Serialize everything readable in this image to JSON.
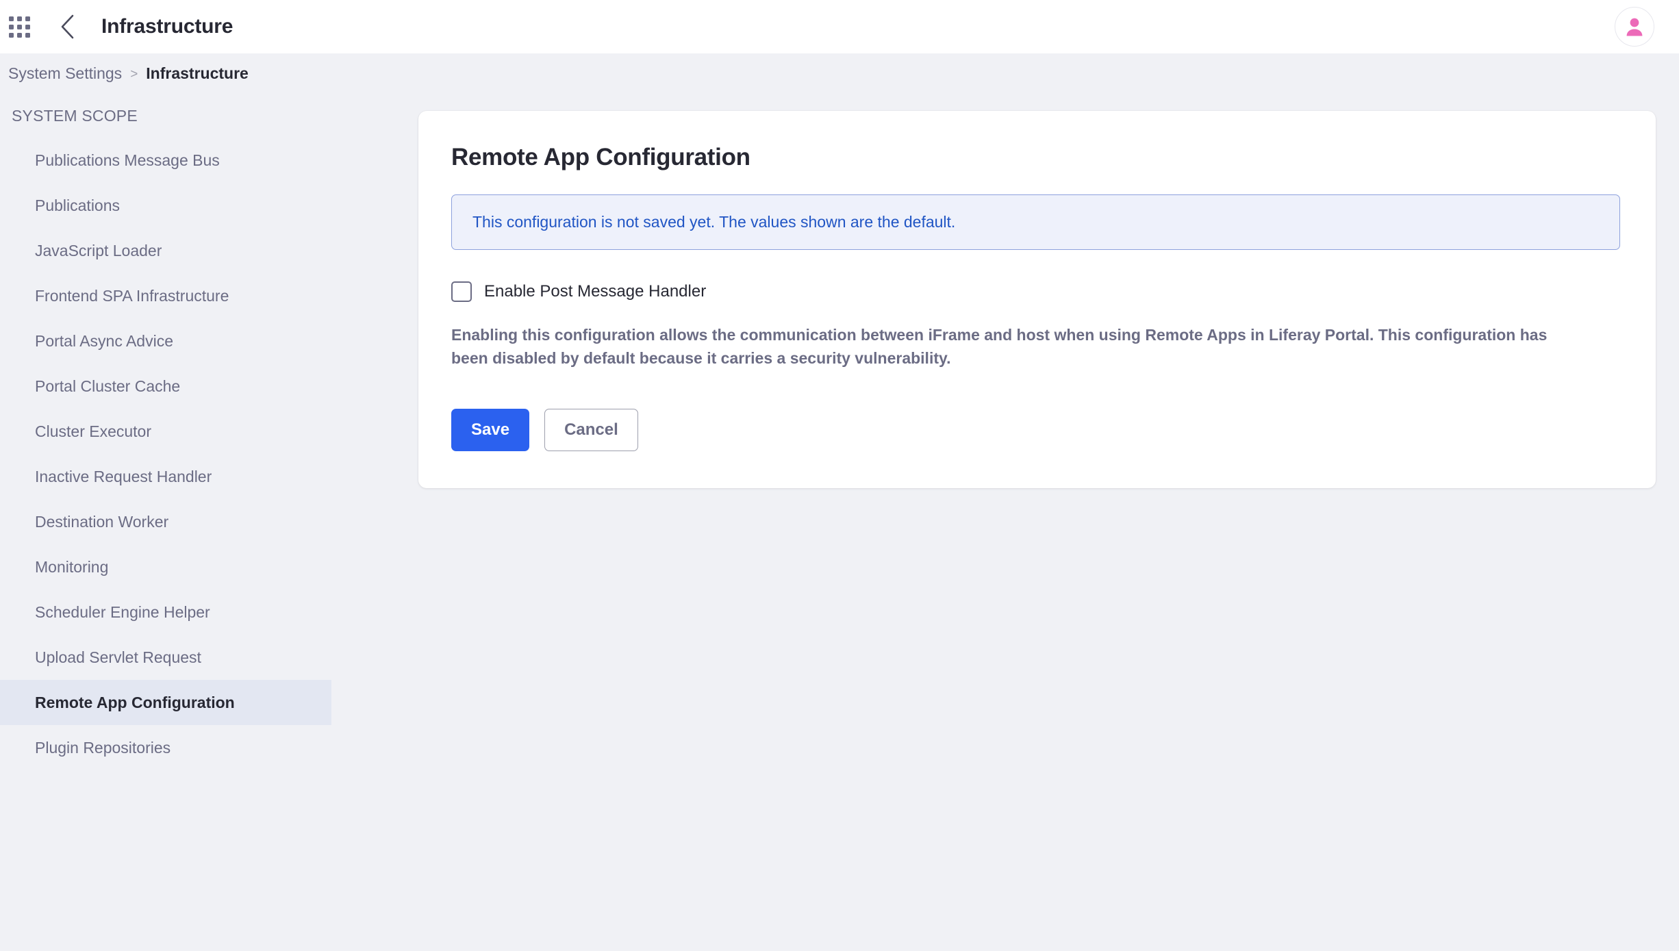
{
  "header": {
    "grid_icon": "apps-grid-icon",
    "back_icon": "chevron-left-icon",
    "title": "Infrastructure",
    "avatar_icon": "user-avatar-icon"
  },
  "breadcrumb": {
    "parent": "System Settings",
    "separator": ">",
    "current": "Infrastructure"
  },
  "sidebar": {
    "heading": "SYSTEM SCOPE",
    "items": [
      {
        "label": "Publications Message Bus",
        "active": false
      },
      {
        "label": "Publications",
        "active": false
      },
      {
        "label": "JavaScript Loader",
        "active": false
      },
      {
        "label": "Frontend SPA Infrastructure",
        "active": false
      },
      {
        "label": "Portal Async Advice",
        "active": false
      },
      {
        "label": "Portal Cluster Cache",
        "active": false
      },
      {
        "label": "Cluster Executor",
        "active": false
      },
      {
        "label": "Inactive Request Handler",
        "active": false
      },
      {
        "label": "Destination Worker",
        "active": false
      },
      {
        "label": "Monitoring",
        "active": false
      },
      {
        "label": "Scheduler Engine Helper",
        "active": false
      },
      {
        "label": "Upload Servlet Request",
        "active": false
      },
      {
        "label": "Remote App Configuration",
        "active": true
      },
      {
        "label": "Plugin Repositories",
        "active": false
      }
    ]
  },
  "main": {
    "card_title": "Remote App Configuration",
    "alert_message": "This configuration is not saved yet. The values shown are the default.",
    "checkbox": {
      "label": "Enable Post Message Handler",
      "checked": false
    },
    "help_text": "Enabling this configuration allows the communication between iFrame and host when using Remote Apps in Liferay Portal. This configuration has been disabled by default because it carries a security vulnerability.",
    "save_label": "Save",
    "cancel_label": "Cancel"
  },
  "colors": {
    "page_background": "#f0f1f5",
    "primary_blue": "#2b61ef",
    "alert_background": "#eef1fb",
    "alert_border": "#8da1dd",
    "alert_text": "#2055c4",
    "active_nav_background": "#e3e7f2",
    "muted_text": "#6b6c84",
    "dark_text": "#272833",
    "avatar_accent": "#ec6ab8"
  }
}
